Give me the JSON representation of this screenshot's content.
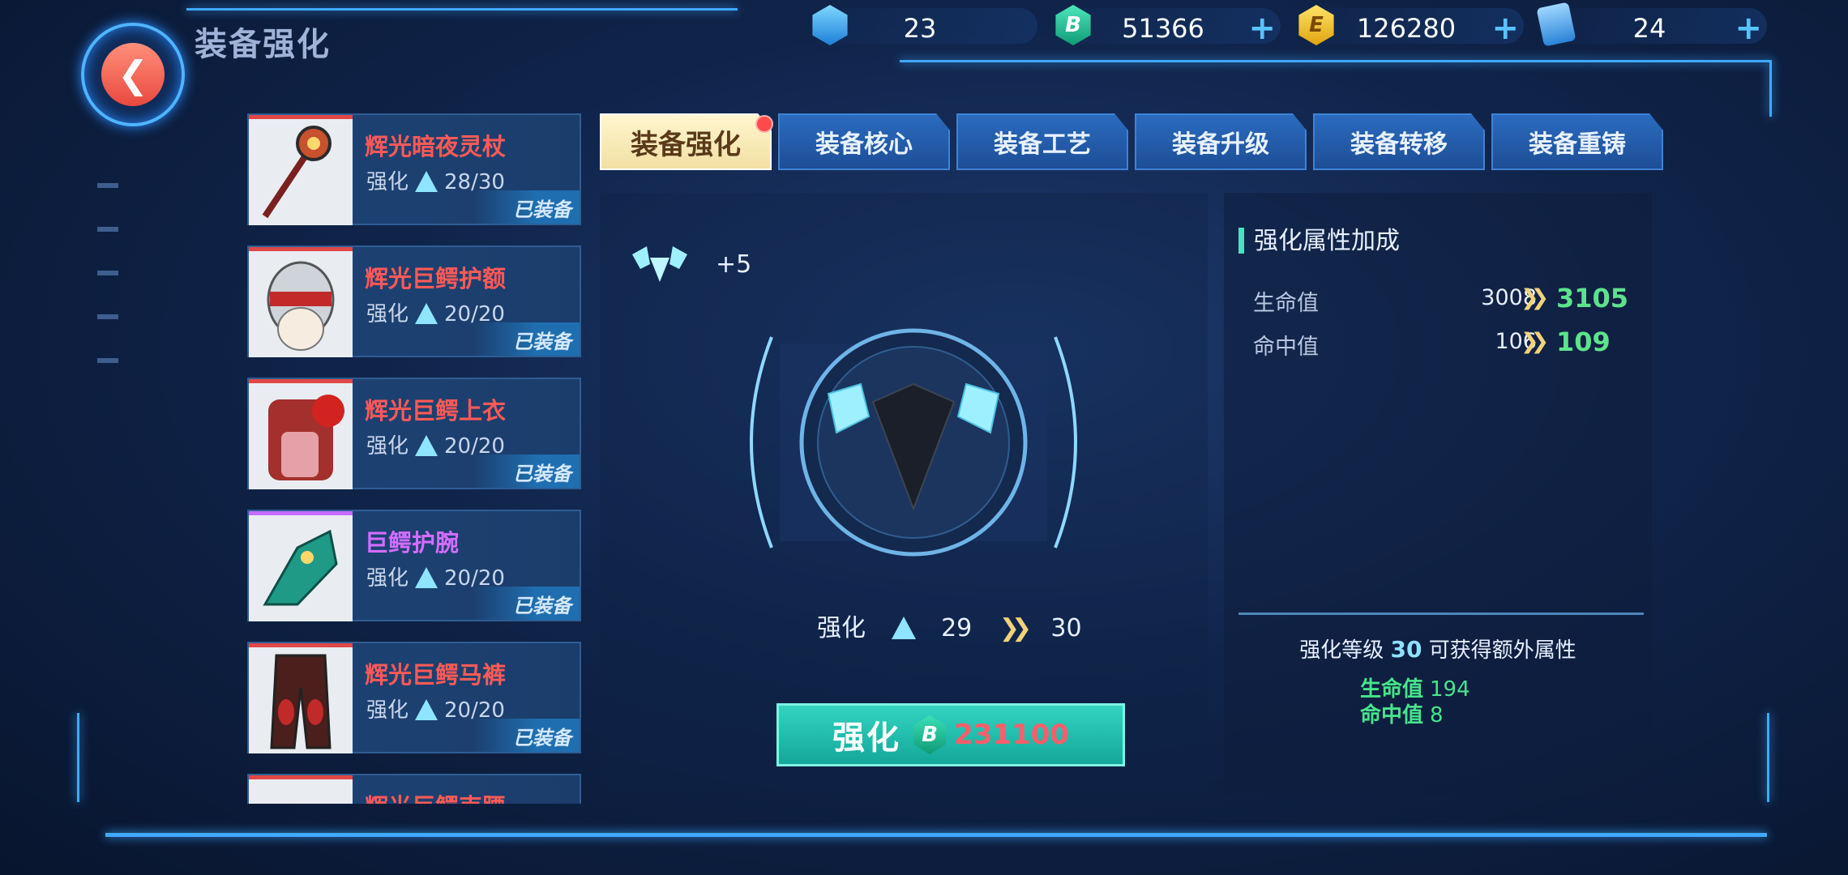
{
  "header": {
    "title": "装备强化"
  },
  "currencies": [
    {
      "icon": "crystal-icon",
      "value": "23",
      "plus": false
    },
    {
      "icon": "b-coin-icon",
      "value": "51366",
      "plus": true
    },
    {
      "icon": "e-coin-icon",
      "value": "126280",
      "plus": true
    },
    {
      "icon": "card-ticket-icon",
      "value": "24",
      "plus": true
    }
  ],
  "equipment": [
    {
      "name": "辉光暗夜灵杖",
      "level_label": "强化",
      "level": "28/30",
      "status": "已装备",
      "rarity": "red"
    },
    {
      "name": "辉光巨鳄护额",
      "level_label": "强化",
      "level": "20/20",
      "status": "已装备",
      "rarity": "red"
    },
    {
      "name": "辉光巨鳄上衣",
      "level_label": "强化",
      "level": "20/20",
      "status": "已装备",
      "rarity": "red"
    },
    {
      "name": "巨鳄护腕",
      "level_label": "强化",
      "level": "20/20",
      "status": "已装备",
      "rarity": "purple"
    },
    {
      "name": "辉光巨鳄马裤",
      "level_label": "强化",
      "level": "20/20",
      "status": "已装备",
      "rarity": "red"
    },
    {
      "name": "辉光巨鳄束腰",
      "level_label": "强化",
      "level": "",
      "status": "",
      "rarity": "red"
    }
  ],
  "tabs": [
    "装备强化",
    "装备核心",
    "装备工艺",
    "装备升级",
    "装备转移",
    "装备重铸"
  ],
  "center": {
    "gem_bonus": "+5",
    "strength_label": "强化",
    "strength_from": "29",
    "strength_to": "30",
    "button_label": "强化",
    "button_cost": "231100"
  },
  "attributes": {
    "heading": "强化属性加成",
    "rows": [
      {
        "name": "生命值",
        "from": "3008",
        "to": "3105"
      },
      {
        "name": "命中值",
        "from": "106",
        "to": "109"
      }
    ]
  },
  "extra": {
    "prefix": "强化等级",
    "level": "30",
    "suffix": "可获得额外属性",
    "rows": [
      {
        "name": "生命值",
        "value": "194"
      },
      {
        "name": "命中值",
        "value": "8"
      }
    ]
  },
  "colors": {
    "accent": "#3fa9ff",
    "rarity_red": "#ff5a55",
    "rarity_purple": "#d36dff",
    "bonus_green": "#5de38a",
    "cost_red": "#ff5d6a"
  }
}
